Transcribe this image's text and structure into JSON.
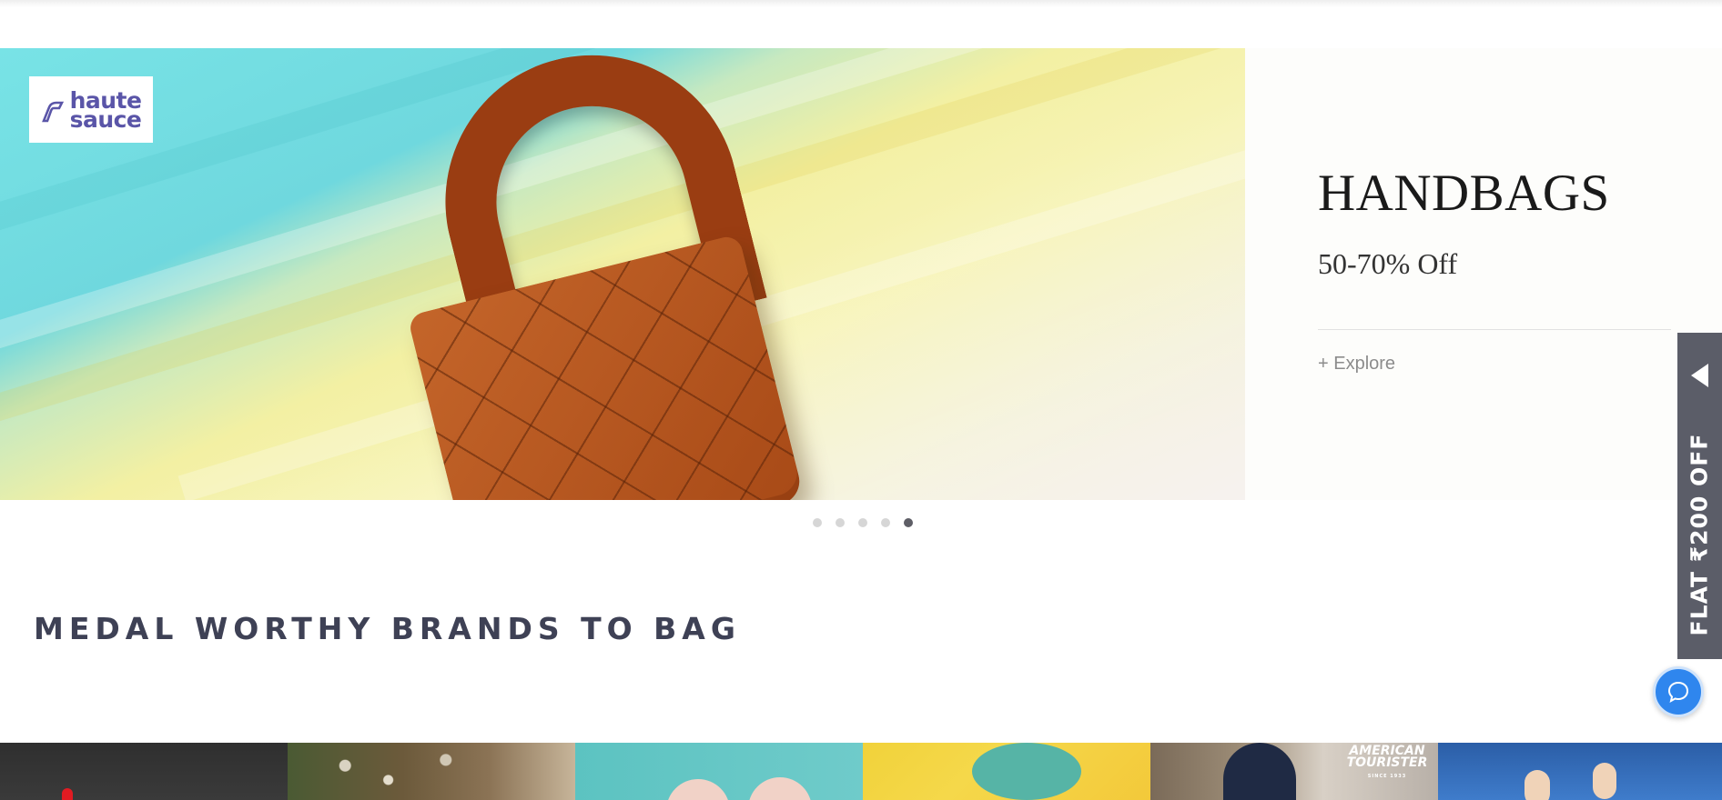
{
  "hero": {
    "logo_line1": "haute",
    "logo_line2": "sauce",
    "image_icon": "handbag-image",
    "promo_title": "HANDBAGS",
    "promo_subtitle": "50-70% Off",
    "explore_link": "+ Explore"
  },
  "carousel": {
    "slide_count": 5,
    "active_index": 4
  },
  "section": {
    "title": "MEDAL WORTHY BRANDS TO BAG"
  },
  "side_offer": {
    "label": "FLAT ₹200 OFF",
    "icon": "triangle-left-icon"
  },
  "chat": {
    "icon": "chat-bubble-icon",
    "color": "#2f86ee"
  },
  "brands": {
    "tiles": [
      {
        "name": "brand-tile-1"
      },
      {
        "name": "brand-tile-2"
      },
      {
        "name": "brand-tile-3"
      },
      {
        "name": "brand-tile-4"
      },
      {
        "name": "brand-tile-5",
        "logo_text": "AMERICAN TOURISTER",
        "logo_tagline": "SINCE 1933"
      },
      {
        "name": "brand-tile-6"
      }
    ]
  },
  "colors": {
    "offer_tab": "#5b5d68",
    "section_title": "#3e4155",
    "active_dot": "#5e5e66",
    "inactive_dot": "#d6d6d6"
  }
}
